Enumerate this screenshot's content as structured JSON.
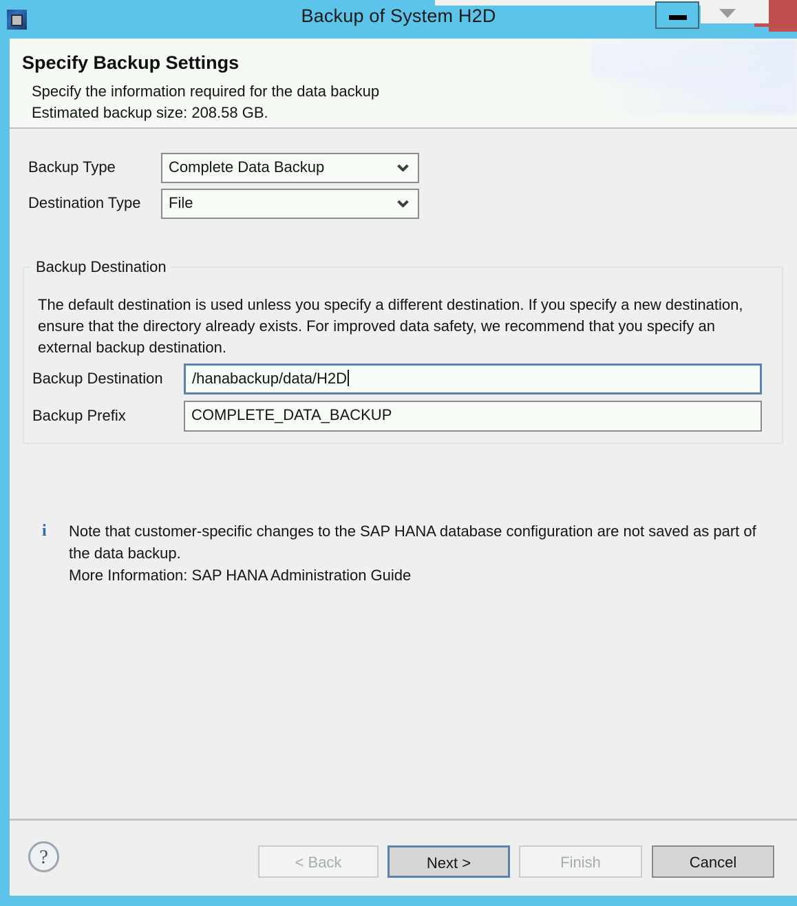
{
  "window": {
    "title": "Backup of System H2D",
    "icon": "app-icon",
    "controls": {
      "minimize": "minimize-button",
      "restore": "restore-button",
      "close": "close-button"
    }
  },
  "header": {
    "title": "Specify Backup Settings",
    "subtitle_line1": "Specify the information required for the data backup",
    "subtitle_line2": "Estimated backup size: 208.58 GB."
  },
  "form": {
    "backup_type": {
      "label": "Backup Type",
      "value": "Complete Data Backup",
      "options": [
        "Complete Data Backup"
      ]
    },
    "destination_type": {
      "label": "Destination Type",
      "value": "File",
      "options": [
        "File"
      ]
    }
  },
  "backup_destination_group": {
    "title": "Backup Destination",
    "description": "The default destination is used unless you specify a different destination. If you specify a new destination, ensure that the directory already exists. For improved data safety, we recommend that you specify an external backup destination.",
    "destination": {
      "label": "Backup Destination",
      "value": "/hanabackup/data/H2D"
    },
    "prefix": {
      "label": "Backup Prefix",
      "value": "COMPLETE_DATA_BACKUP"
    }
  },
  "note": {
    "icon": "info-icon",
    "text": "Note that customer-specific changes to the SAP HANA database configuration are not saved as part of the data backup.",
    "more_information": "More Information: SAP HANA Administration Guide"
  },
  "buttons": {
    "help": "?",
    "back": "< Back",
    "next": "Next >",
    "finish": "Finish",
    "cancel": "Cancel"
  },
  "colors": {
    "window_frame": "#5bc4e8",
    "close_button": "#c0504d",
    "client_background": "#efefef",
    "header_background": "#f5faf5",
    "field_background": "#f6fbf6",
    "focus_border": "#5a84ae",
    "info_icon": "#2b6cb0"
  }
}
